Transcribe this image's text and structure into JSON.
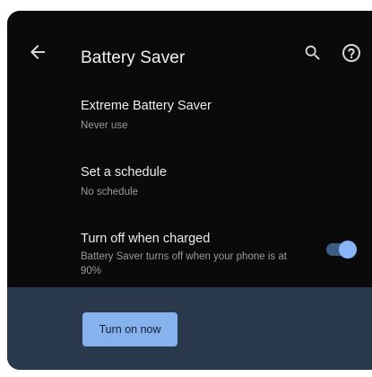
{
  "app_bar": {
    "title": "Battery Saver",
    "back_icon": "arrow-back-icon",
    "search_icon": "search-icon",
    "help_icon": "help-circle-icon"
  },
  "preferences": [
    {
      "title": "Extreme Battery Saver",
      "summary": "Never use"
    },
    {
      "title": "Set a schedule",
      "summary": "No schedule"
    },
    {
      "title": "Turn off when charged",
      "summary": "Battery Saver turns off when your phone is at 90%",
      "toggle_on": true
    }
  ],
  "footer": {
    "turn_on_label": "Turn on now"
  },
  "colors": {
    "background": "#0a0a0a",
    "footer": "#2a3a4c",
    "accent": "#8ab4f8",
    "primary_text": "#ececec",
    "secondary_text": "#9a9a9a"
  }
}
